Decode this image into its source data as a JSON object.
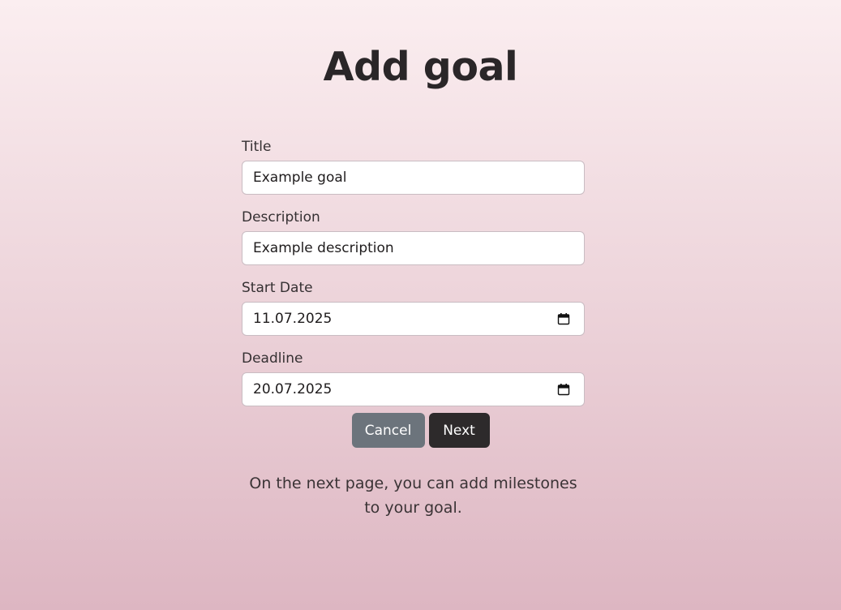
{
  "page": {
    "title": "Add goal",
    "footer_note": "On the next page, you can add milestones to your goal."
  },
  "form": {
    "fields": [
      {
        "label": "Title",
        "value": "Example goal",
        "type": "text"
      },
      {
        "label": "Description",
        "value": "Example description",
        "type": "text"
      },
      {
        "label": "Start Date",
        "value": "11.07.2025",
        "type": "date",
        "icon": "calendar-icon"
      },
      {
        "label": "Deadline",
        "value": "20.07.2025",
        "type": "date",
        "icon": "calendar-icon"
      }
    ]
  },
  "buttons": {
    "cancel_label": "Cancel",
    "next_label": "Next"
  },
  "colors": {
    "cancel_button": "#6c747c",
    "next_button": "#2d2a2b",
    "background_top": "#fbeef0",
    "background_bottom": "#ddb6c2"
  }
}
